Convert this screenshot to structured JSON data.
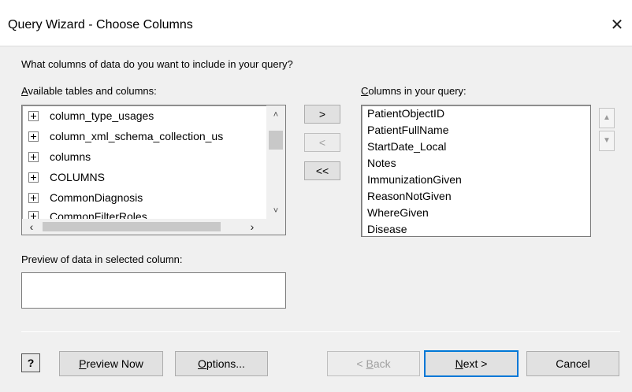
{
  "window": {
    "title": "Query Wizard - Choose Columns",
    "close_glyph": "✕"
  },
  "prompt": "What columns of data do you want to include in your query?",
  "available": {
    "label_accel": "A",
    "label_rest": "vailable tables and columns:",
    "items": [
      "column_type_usages",
      "column_xml_schema_collection_us",
      "columns",
      "COLUMNS",
      "CommonDiagnosis",
      "CommonFilterRoles"
    ]
  },
  "move_buttons": {
    "add": ">",
    "remove": "<",
    "remove_all": "<<"
  },
  "query": {
    "label_accel": "C",
    "label_rest": "olumns in your query:",
    "items": [
      "PatientObjectID",
      "PatientFullName",
      "StartDate_Local",
      "Notes",
      "ImmunizationGiven",
      "ReasonNotGiven",
      "WhereGiven",
      "Disease"
    ]
  },
  "order_buttons": {
    "up": "▲",
    "down": "▼"
  },
  "preview": {
    "label": "Preview of data in selected column:",
    "value": ""
  },
  "footer": {
    "help": "?",
    "preview_now_accel": "P",
    "preview_now_rest": "review Now",
    "options_accel": "O",
    "options_rest": "ptions...",
    "back_prefix": "< ",
    "back_accel": "B",
    "back_rest": "ack",
    "next_accel": "N",
    "next_rest": "ext >",
    "cancel": "Cancel"
  },
  "colors": {
    "window_bg": "#f0f0f0",
    "title_bg": "#ffffff",
    "default_button_border": "#0078d7"
  }
}
